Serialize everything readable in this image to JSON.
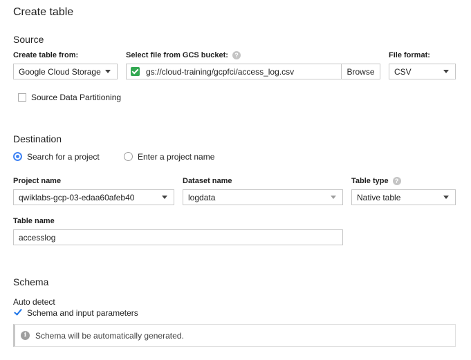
{
  "page_title": "Create table",
  "source": {
    "heading": "Source",
    "create_from_label": "Create table from:",
    "create_from_value": "Google Cloud Storage",
    "gcs_label": "Select file from GCS bucket:",
    "gcs_path": "gs://cloud-training/gcpfci/access_log.csv",
    "browse_label": "Browse",
    "format_label": "File format:",
    "format_value": "CSV",
    "partitioning_label": "Source Data Partitioning"
  },
  "destination": {
    "heading": "Destination",
    "radio_search": "Search for a project",
    "radio_enter": "Enter a project name",
    "project_label": "Project name",
    "project_value": "qwiklabs-gcp-03-edaa60afeb40",
    "dataset_label": "Dataset name",
    "dataset_value": "logdata",
    "table_type_label": "Table type",
    "table_type_value": "Native table",
    "table_name_label": "Table name",
    "table_name_value": "accesslog"
  },
  "schema": {
    "heading": "Schema",
    "auto_detect_label": "Auto detect",
    "schema_checkbox_label": "Schema and input parameters",
    "info_message": "Schema will be automatically generated."
  },
  "icons": {
    "help": "?",
    "info": "i"
  },
  "colors": {
    "accent": "#4285f4",
    "check_green": "#33a852"
  }
}
